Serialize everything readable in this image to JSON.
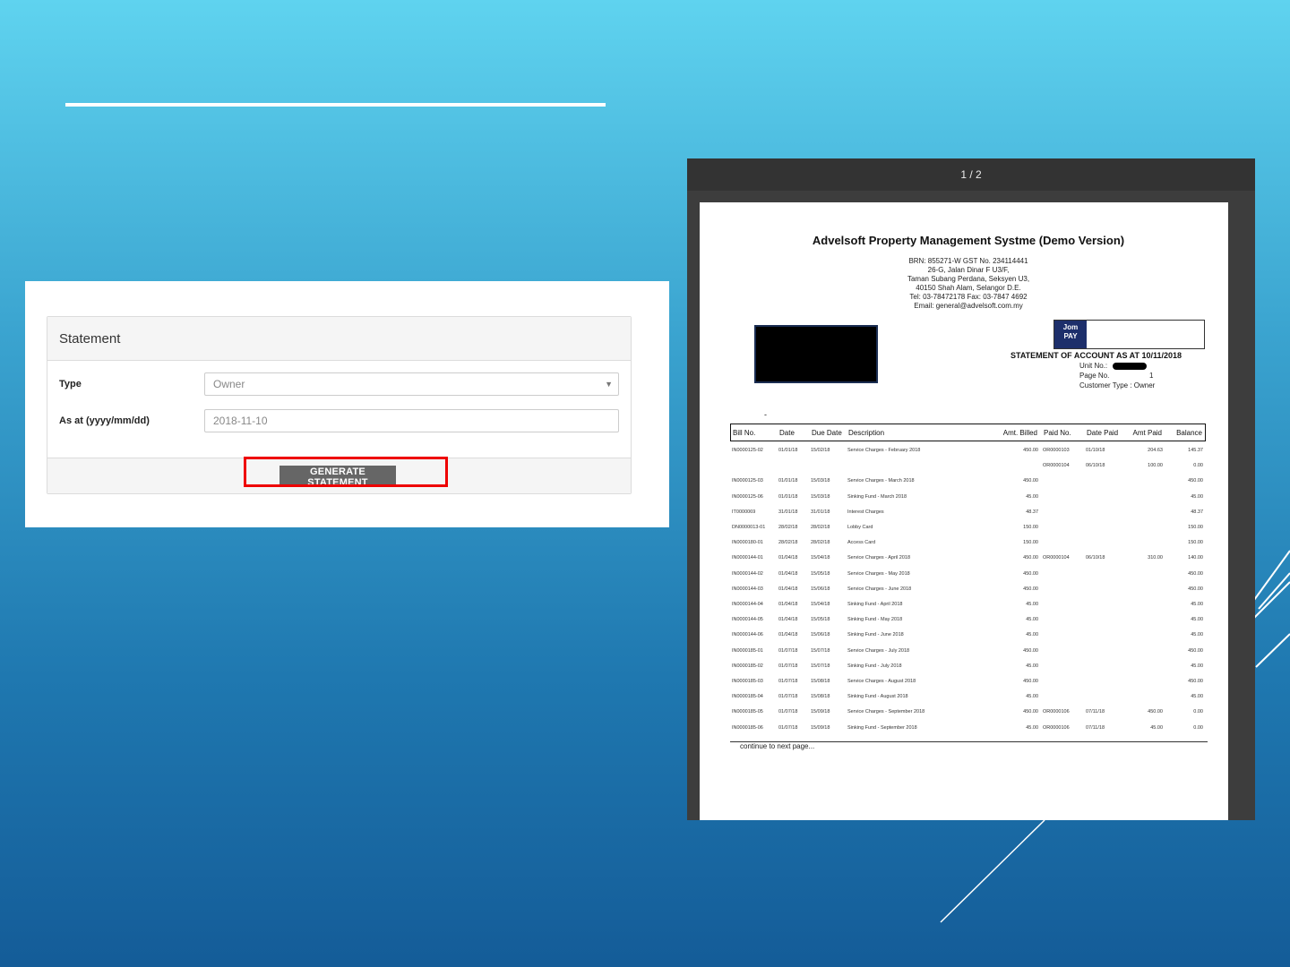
{
  "form": {
    "heading": "Statement",
    "type_label": "Type",
    "type_value": "Owner",
    "asat_label": "As at (yyyy/mm/dd)",
    "asat_value": "2018-11-10",
    "button_label": "GENERATE STATEMENT"
  },
  "viewer": {
    "page_indicator": "1 / 2",
    "title": "Advelsoft Property Management Systme (Demo Version)",
    "address_lines": [
      "BRN: 855271-W            GST No. 234114441",
      "26-G, Jalan Dinar F U3/F,",
      "Taman Subang Perdana, Seksyen U3,",
      "40150 Shah Alam, Selangor D.E.",
      "Tel: 03-78472178    Fax: 03-7847 4692",
      "Email: general@advelsoft.com.my"
    ],
    "jompay_line1": "Jom",
    "jompay_line2": "PAY",
    "soa_title": "STATEMENT OF ACCOUNT AS AT 10/11/2018",
    "unit_no_label": "Unit No.:",
    "page_no_label": "Page No.",
    "page_no_value": "1",
    "customer_type": "Customer Type : Owner",
    "dash": "-",
    "columns": {
      "bill": "Bill No.",
      "date": "Date",
      "due": "Due Date",
      "desc": "Description",
      "billed": "Amt. Billed",
      "paidno": "Paid No.",
      "datepaid": "Date Paid",
      "amtpaid": "Amt Paid",
      "bal": "Balance"
    },
    "rows": [
      [
        "IN0000125-02",
        "01/01/18",
        "15/02/18",
        "Service Charges - February 2018",
        "450.00",
        "OR0000103",
        "01/10/18",
        "204.63",
        "145.37"
      ],
      [
        "",
        "",
        "",
        "",
        "",
        "OR0000104",
        "06/10/18",
        "100.00",
        "0.00"
      ],
      [
        "IN0000125-03",
        "01/01/18",
        "15/03/18",
        "Service Charges - March 2018",
        "450.00",
        "",
        "",
        "",
        "450.00"
      ],
      [
        "IN0000125-06",
        "01/01/18",
        "15/03/18",
        "Sinking Fund - March 2018",
        "45.00",
        "",
        "",
        "",
        "45.00"
      ],
      [
        "IT0000069",
        "31/01/18",
        "31/01/18",
        "Interest Charges",
        "48.37",
        "",
        "",
        "",
        "48.37"
      ],
      [
        "DN0000013-01",
        "28/02/18",
        "28/02/18",
        "Lobby Card",
        "150.00",
        "",
        "",
        "",
        "150.00"
      ],
      [
        "IN0000180-01",
        "28/02/18",
        "28/02/18",
        "Access Card",
        "150.00",
        "",
        "",
        "",
        "150.00"
      ],
      [
        "IN0000144-01",
        "01/04/18",
        "15/04/18",
        "Service Charges - April 2018",
        "450.00",
        "OR0000104",
        "06/10/18",
        "310.00",
        "140.00"
      ],
      [
        "IN0000144-02",
        "01/04/18",
        "15/05/18",
        "Service Charges - May 2018",
        "450.00",
        "",
        "",
        "",
        "450.00"
      ],
      [
        "IN0000144-03",
        "01/04/18",
        "15/06/18",
        "Service Charges - June 2018",
        "450.00",
        "",
        "",
        "",
        "450.00"
      ],
      [
        "IN0000144-04",
        "01/04/18",
        "15/04/18",
        "Sinking Fund - April 2018",
        "45.00",
        "",
        "",
        "",
        "45.00"
      ],
      [
        "IN0000144-05",
        "01/04/18",
        "15/05/18",
        "Sinking Fund - May 2018",
        "45.00",
        "",
        "",
        "",
        "45.00"
      ],
      [
        "IN0000144-06",
        "01/04/18",
        "15/06/18",
        "Sinking Fund - June 2018",
        "45.00",
        "",
        "",
        "",
        "45.00"
      ],
      [
        "IN0000185-01",
        "01/07/18",
        "15/07/18",
        "Service Charges - July 2018",
        "450.00",
        "",
        "",
        "",
        "450.00"
      ],
      [
        "IN0000185-02",
        "01/07/18",
        "15/07/18",
        "Sinking Fund - July 2018",
        "45.00",
        "",
        "",
        "",
        "45.00"
      ],
      [
        "IN0000185-03",
        "01/07/18",
        "15/08/18",
        "Service Charges - August 2018",
        "450.00",
        "",
        "",
        "",
        "450.00"
      ],
      [
        "IN0000185-04",
        "01/07/18",
        "15/08/18",
        "Sinking Fund - August 2018",
        "45.00",
        "",
        "",
        "",
        "45.00"
      ],
      [
        "IN0000185-05",
        "01/07/18",
        "15/09/18",
        "Service Charges - September 2018",
        "450.00",
        "OR0000106",
        "07/11/18",
        "450.00",
        "0.00"
      ],
      [
        "IN0000185-06",
        "01/07/18",
        "15/09/18",
        "Sinking Fund - September 2018",
        "45.00",
        "OR0000106",
        "07/11/18",
        "45.00",
        "0.00"
      ]
    ],
    "continue_text": "continue to next page..."
  }
}
